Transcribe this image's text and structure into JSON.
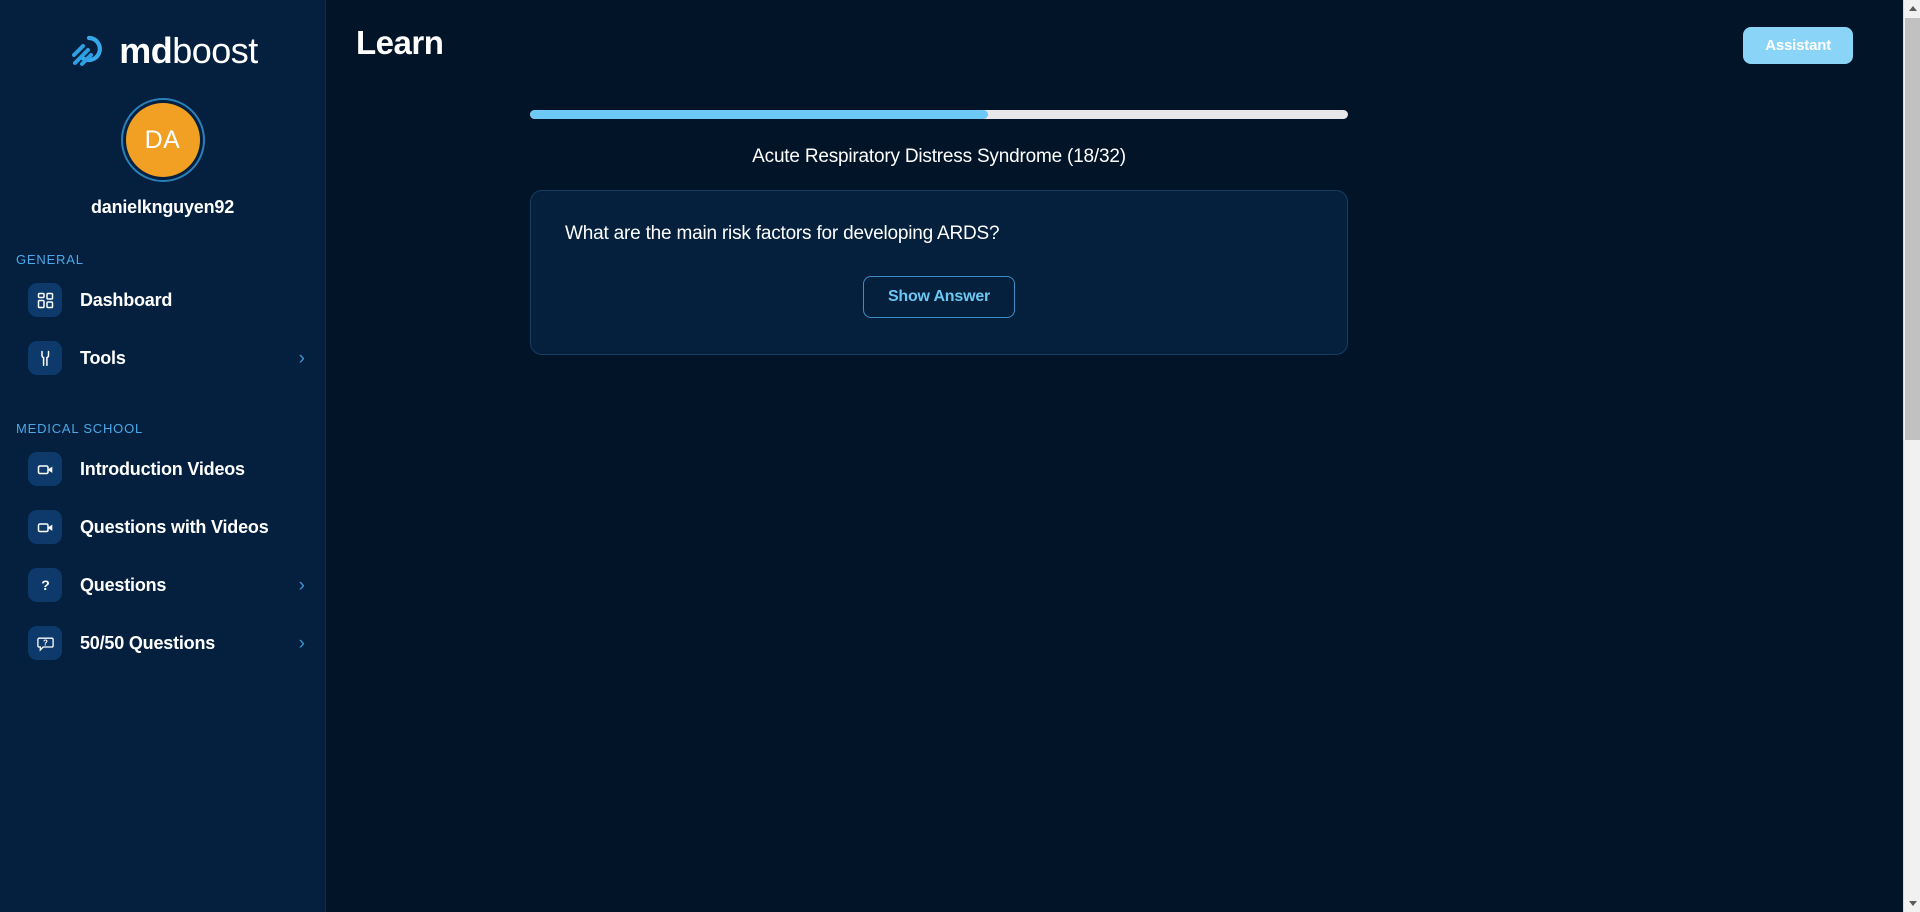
{
  "brand": {
    "logo_icon": "comet-logo-icon",
    "name_bold": "md",
    "name_light": "boost",
    "accent_blue": "#35a8ea",
    "accent_light_blue": "#8ad4f7"
  },
  "sidebar": {
    "background": "#05203f",
    "avatar": {
      "initials": "DA",
      "color": "#f2a024",
      "ring_color": "#2a7fb8"
    },
    "username": "danielknguyen92",
    "sections": [
      {
        "label": "GENERAL",
        "items": [
          {
            "label": "Dashboard",
            "icon": "grid-icon",
            "has_chevron": false
          },
          {
            "label": "Tools",
            "icon": "wrench-icon",
            "has_chevron": true
          }
        ]
      },
      {
        "label": "MEDICAL SCHOOL",
        "items": [
          {
            "label": "Introduction Videos",
            "icon": "video-camera-icon",
            "has_chevron": false
          },
          {
            "label": "Questions with Videos",
            "icon": "video-camera-icon",
            "has_chevron": false
          },
          {
            "label": "Questions",
            "icon": "question-mark-icon",
            "has_chevron": true
          },
          {
            "label": "50/50 Questions",
            "icon": "question-bubble-icon",
            "has_chevron": true
          }
        ]
      }
    ],
    "chevron_glyph": "›"
  },
  "header": {
    "title": "Learn",
    "assistant_button": "Assistant"
  },
  "learn": {
    "progress": {
      "current": 18,
      "total": 32,
      "percent": 56,
      "fill_color": "#6ec8f5",
      "track_color": "#e8e8ea"
    },
    "topic_title": "Acute Respiratory Distress Syndrome (18/32)",
    "question": "What are the main risk factors for developing ARDS?",
    "show_answer_button": "Show Answer"
  },
  "scrollbar": {
    "up_arrow_icon": "scroll-up-arrow-icon",
    "down_arrow_icon": "scroll-down-arrow-icon"
  }
}
